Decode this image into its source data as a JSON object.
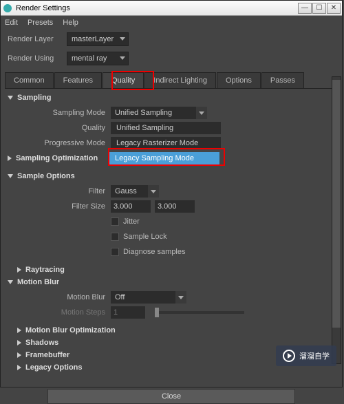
{
  "window": {
    "title": "Render Settings"
  },
  "menu": {
    "edit": "Edit",
    "presets": "Presets",
    "help": "Help"
  },
  "renderLayer": {
    "label": "Render Layer",
    "value": "masterLayer"
  },
  "renderUsing": {
    "label": "Render Using",
    "value": "mental ray"
  },
  "tabs": {
    "common": "Common",
    "features": "Features",
    "quality": "Quality",
    "indirect": "Indirect Lighting",
    "options": "Options",
    "passes": "Passes"
  },
  "sampling": {
    "header": "Sampling",
    "mode_label": "Sampling Mode",
    "mode_value": "Unified Sampling",
    "options": {
      "quality_label": "Quality",
      "unified": "Unified Sampling",
      "progressive_label": "Progressive Mode",
      "legacy_rast": "Legacy Rasterizer Mode",
      "legacy_sampling": "Legacy Sampling Mode"
    },
    "optimization_header": "Sampling Optimization"
  },
  "sample_options": {
    "header": "Sample Options",
    "filter_label": "Filter",
    "filter_value": "Gauss",
    "filter_size_label": "Filter Size",
    "filter_w": "3.000",
    "filter_h": "3.000",
    "jitter": "Jitter",
    "sample_lock": "Sample Lock",
    "diagnose": "Diagnose samples"
  },
  "sections": {
    "raytracing": "Raytracing",
    "motion_blur": "Motion Blur",
    "motion_blur_opt": "Motion Blur Optimization",
    "shadows": "Shadows",
    "framebuffer": "Framebuffer",
    "legacy_options": "Legacy Options"
  },
  "motion_blur": {
    "label": "Motion Blur",
    "value": "Off",
    "steps_label": "Motion Steps",
    "steps_value": "1"
  },
  "close": "Close",
  "watermark": "溜溜自学"
}
